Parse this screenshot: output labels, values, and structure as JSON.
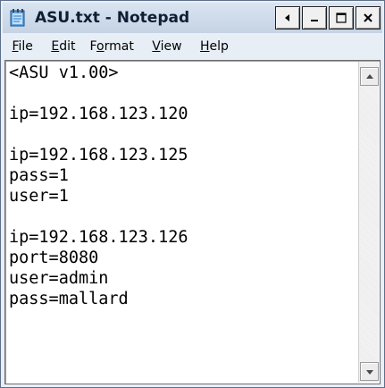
{
  "window": {
    "title": "ASU.txt - Notepad"
  },
  "menu": [
    {
      "label_prefix": "",
      "accel": "F",
      "label_suffix": "ile"
    },
    {
      "label_prefix": "",
      "accel": "E",
      "label_suffix": "dit"
    },
    {
      "label_prefix": "F",
      "accel": "o",
      "label_suffix": "rmat"
    },
    {
      "label_prefix": "",
      "accel": "V",
      "label_suffix": "iew"
    },
    {
      "label_prefix": "",
      "accel": "H",
      "label_suffix": "elp"
    }
  ],
  "document": {
    "lines": [
      "<ASU v1.00>",
      "",
      "ip=192.168.123.120",
      "",
      "ip=192.168.123.125",
      "pass=1",
      "user=1",
      "",
      "ip=192.168.123.126",
      "port=8080",
      "user=admin",
      "pass=mallard"
    ]
  },
  "icons": {
    "app": "notepad-icon",
    "scroll_left": "scroll-left-icon",
    "minimize": "minimize-icon",
    "maximize": "maximize-icon",
    "close": "close-icon",
    "scroll_up": "scroll-up-icon",
    "scroll_down": "scroll-down-icon"
  }
}
